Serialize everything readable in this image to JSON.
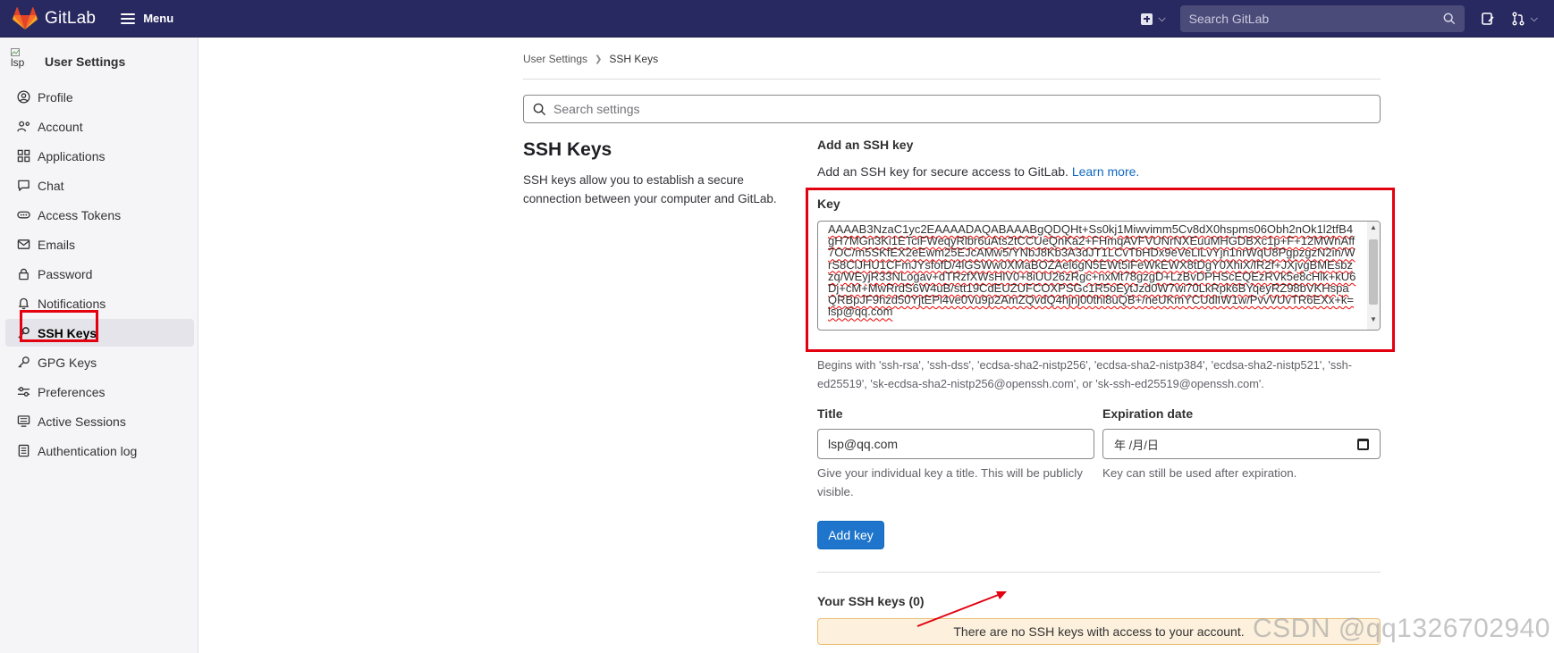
{
  "topbar": {
    "brand_name": "GitLab",
    "menu_label": "Menu",
    "search_placeholder": "Search GitLab"
  },
  "sidebar": {
    "avatar_text": "lsp",
    "title": "User Settings",
    "items": [
      {
        "label": "Profile",
        "icon": "profile-icon"
      },
      {
        "label": "Account",
        "icon": "account-icon"
      },
      {
        "label": "Applications",
        "icon": "applications-icon"
      },
      {
        "label": "Chat",
        "icon": "chat-icon"
      },
      {
        "label": "Access Tokens",
        "icon": "token-icon"
      },
      {
        "label": "Emails",
        "icon": "email-icon"
      },
      {
        "label": "Password",
        "icon": "lock-icon"
      },
      {
        "label": "Notifications",
        "icon": "bell-icon"
      },
      {
        "label": "SSH Keys",
        "icon": "key-icon",
        "active": true
      },
      {
        "label": "GPG Keys",
        "icon": "key-icon"
      },
      {
        "label": "Preferences",
        "icon": "preferences-icon"
      },
      {
        "label": "Active Sessions",
        "icon": "monitor-icon"
      },
      {
        "label": "Authentication log",
        "icon": "log-icon"
      }
    ]
  },
  "breadcrumb": {
    "parent": "User Settings",
    "current": "SSH Keys"
  },
  "settings_search": {
    "placeholder": "Search settings"
  },
  "section": {
    "title": "SSH Keys",
    "description": "SSH keys allow you to establish a secure connection between your computer and GitLab."
  },
  "form": {
    "add_title": "Add an SSH key",
    "add_desc": "Add an SSH key for secure access to GitLab.",
    "learn_more": "Learn more.",
    "key_label": "Key",
    "key_value": "AAAAB3NzaC1yc2EAAAADAQABAAABgQDQHt+Ss0kj1Miwvimm5Cv8dX0hspms06Obh2nOk1l2tfB4gH7MGn3Ki1ETciFWeqyRlbr6uAts2tCCUeQnKa2+FHmqAVFVUNrNXEuuMHGDBXc1p+F+12MWnAff7OC/m5SKfEX2eEwm25EJcAMw5/YNbJ8Kb3A3dJT1LCvTbHDx9eVeLiLvYjn1nrWqU8PgpzgzN2in/WrS8ClJHU1CFmJYsfofD/4lGSWw0XMaBOZAel6gN5EWt5iFeWkEWX8tDgY0XhiX/lR2f+JXjvgBMEsbzzq/WEyjR33NLogav+dTRzfXWsHlV0+8iUU26zRgc+nxMt78gzgD+LzBvDPHScEQEzRVk5e8cHlk+kU6Dj+cM+MwRrdS6W4uB/stt19CdEUZUFCOXPSGc1R5oEytJzd0W7wi70LkRpk6BYqeyRZ98bVKHspaQRBpJF9hzd50YjtEPi4ve0Vu9p2AmZQvdQ4hjnj00thi8uQB+/neUKmYCUdlIW1w/PvvVUvTR6EXx+k= lsp@qq.com",
    "key_hint": "Begins with 'ssh-rsa', 'ssh-dss', 'ecdsa-sha2-nistp256', 'ecdsa-sha2-nistp384', 'ecdsa-sha2-nistp521', 'ssh-ed25519', 'sk-ecdsa-sha2-nistp256@openssh.com', or 'sk-ssh-ed25519@openssh.com'.",
    "title_label": "Title",
    "title_value": "lsp@qq.com",
    "title_hint": "Give your individual key a title. This will be publicly visible.",
    "exp_label": "Expiration date",
    "exp_value": "年 /月/日",
    "exp_hint": "Key can still be used after expiration.",
    "add_button": "Add key",
    "your_keys": "Your SSH keys (0)",
    "empty_alert": "There are no SSH keys with access to your account."
  },
  "watermark": "CSDN @qq1326702940",
  "colors": {
    "navbar": "#292961",
    "primary": "#1f75cb",
    "annotation": "#e3000f",
    "alert_bg": "#fdf1dd"
  }
}
